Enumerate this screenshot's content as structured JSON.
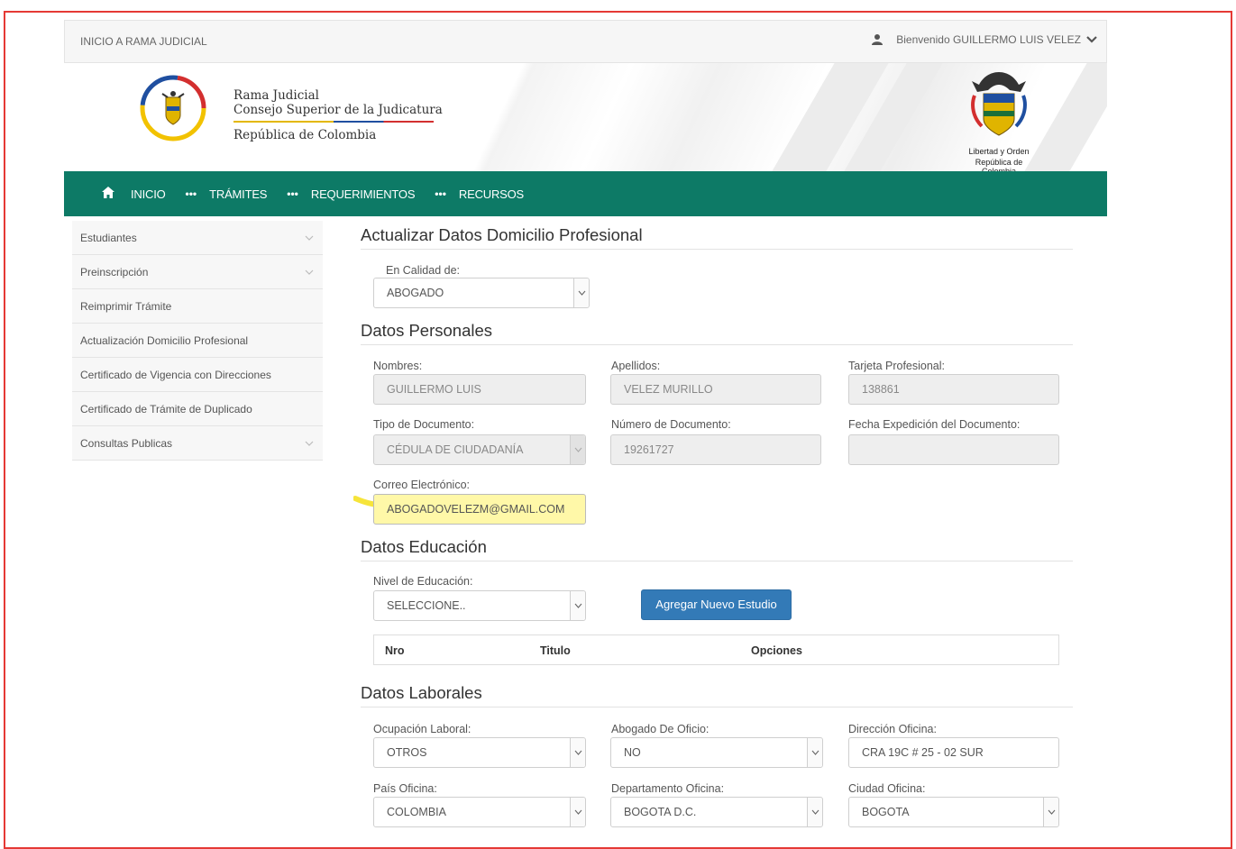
{
  "topbar": {
    "home_link": "INICIO A RAMA JUDICIAL",
    "welcome": "Bienvenido GUILLERMO LUIS VELEZ"
  },
  "brand": {
    "line1": "Rama Judicial",
    "line2": "Consejo Superior de la Judicatura",
    "line3": "República de Colombia",
    "coat_motto_1": "Libertad y Orden",
    "coat_motto_2": "República de Colombia"
  },
  "nav": {
    "items": [
      {
        "label": "INICIO"
      },
      {
        "label": "TRÁMITES"
      },
      {
        "label": "REQUERIMIENTOS"
      },
      {
        "label": "RECURSOS"
      }
    ],
    "color": "#0d7a66"
  },
  "sidebar": {
    "items": [
      {
        "label": "Estudiantes"
      },
      {
        "label": "Preinscripción"
      },
      {
        "label": "Reimprimir Trámite"
      },
      {
        "label": "Actualización Domicilio Profesional"
      },
      {
        "label": "Certificado de Vigencia con Direcciones"
      },
      {
        "label": "Certificado de Trámite de Duplicado"
      },
      {
        "label": "Consultas Publicas"
      }
    ]
  },
  "main": {
    "title": "Actualizar Datos Domicilio Profesional",
    "calidad": {
      "label": "En Calidad de:",
      "value": "ABOGADO"
    },
    "personal": {
      "title": "Datos Personales",
      "nombres": {
        "label": "Nombres:",
        "value": "GUILLERMO LUIS"
      },
      "apellidos": {
        "label": "Apellidos:",
        "value": "VELEZ MURILLO"
      },
      "tarjeta": {
        "label": "Tarjeta Profesional:",
        "value": "138861"
      },
      "tipo_doc": {
        "label": "Tipo de Documento:",
        "value": "CÉDULA DE CIUDADANÍA"
      },
      "num_doc": {
        "label": "Número de Documento:",
        "value": "19261727"
      },
      "fecha_exp": {
        "label": "Fecha Expedición del Documento:",
        "value": ""
      },
      "correo": {
        "label": "Correo Electrónico:",
        "value": "ABOGADOVELEZM@GMAIL.COM"
      }
    },
    "educacion": {
      "title": "Datos Educación",
      "nivel": {
        "label": "Nivel de Educación:",
        "value": "SELECCIONE.."
      },
      "add_button": "Agregar Nuevo Estudio",
      "table_headers": [
        "Nro",
        "Titulo",
        "Opciones"
      ]
    },
    "laborales": {
      "title": "Datos Laborales",
      "ocupacion": {
        "label": "Ocupación Laboral:",
        "value": "OTROS"
      },
      "oficio": {
        "label": "Abogado De Oficio:",
        "value": "NO"
      },
      "direccion": {
        "label": "Dirección Oficina:",
        "value": "CRA 19C # 25 - 02 SUR"
      },
      "pais": {
        "label": "País Oficina:",
        "value": "COLOMBIA"
      },
      "departamento": {
        "label": "Departamento Oficina:",
        "value": "BOGOTA D.C."
      },
      "ciudad": {
        "label": "Ciudad Oficina:",
        "value": "BOGOTA"
      }
    }
  }
}
